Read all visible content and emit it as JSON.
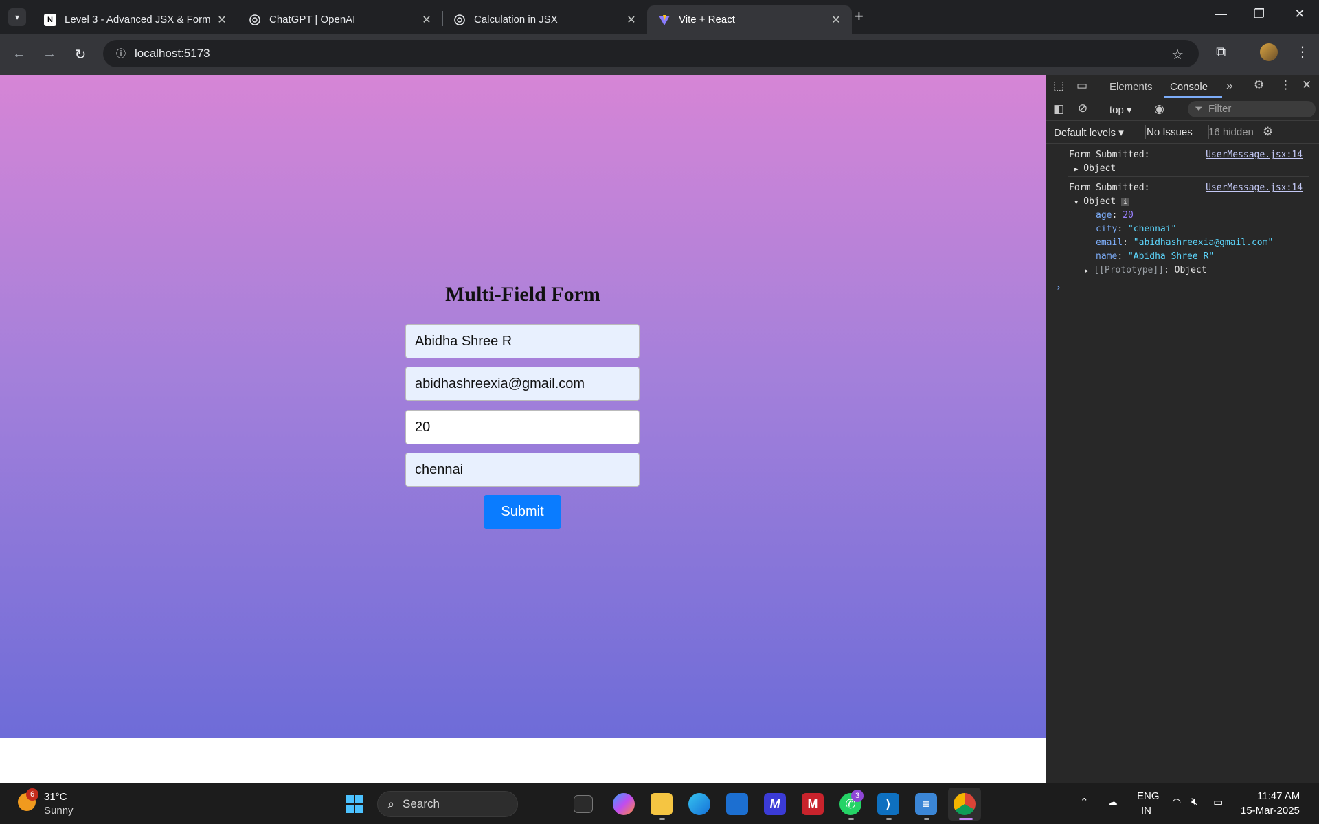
{
  "browser": {
    "tabs": [
      {
        "label": "Level 3 - Advanced JSX & Form",
        "favicon": "N"
      },
      {
        "label": "ChatGPT | OpenAI",
        "favicon": "openai-icon"
      },
      {
        "label": "Calculation in JSX",
        "favicon": "openai-icon"
      },
      {
        "label": "Vite + React",
        "favicon": "vite-icon",
        "active": true
      }
    ],
    "url": "localhost:5173"
  },
  "page": {
    "title": "Multi-Field Form",
    "fields": {
      "name": "Abidha Shree R",
      "email": "abidhashreexia@gmail.com",
      "age": "20",
      "city": "chennai"
    },
    "submit_label": "Submit",
    "colors": {
      "gradient_top": "#d685d6",
      "gradient_bottom": "#6e6cd8",
      "button": "#0a7cff"
    }
  },
  "devtools": {
    "tabs": {
      "elements": "Elements",
      "console": "Console"
    },
    "context": "top ▾",
    "filter_placeholder": "Filter",
    "levels": "Default levels ▾",
    "issues": "No Issues",
    "hidden": "16 hidden",
    "logs": [
      {
        "message": "Form Submitted:",
        "source": "UserMessage.jsx:14",
        "object": "Object"
      },
      {
        "message": "Form Submitted:",
        "source": "UserMessage.jsx:14",
        "object": "Object"
      }
    ],
    "object_props": {
      "age_key": "age",
      "age_val": "20",
      "city_key": "city",
      "city_val": "\"chennai\"",
      "email_key": "email",
      "email_val": "\"abidhashreexia@gmail.com\"",
      "name_key": "name",
      "name_val": "\"Abidha Shree R\"",
      "proto_key": "[[Prototype]]",
      "proto_val": "Object"
    }
  },
  "taskbar": {
    "weather_badge": "6",
    "temp": "31°C",
    "condition": "Sunny",
    "search_label": "Search",
    "whatsapp_badge": "3",
    "lang_top": "ENG",
    "lang_bottom": "IN",
    "time": "11:47 AM",
    "date": "15-Mar-2025"
  }
}
